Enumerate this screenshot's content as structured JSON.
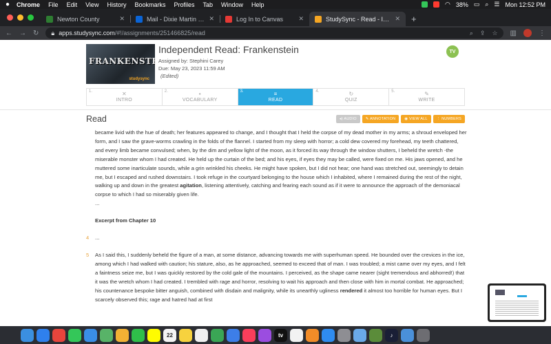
{
  "menubar": {
    "app": "Chrome",
    "items": [
      "File",
      "Edit",
      "View",
      "History",
      "Bookmarks",
      "Profiles",
      "Tab",
      "Window",
      "Help"
    ],
    "battery": "38%",
    "clock": "Mon 12:52 PM"
  },
  "tabs": [
    {
      "title": "Newton County",
      "color": "#2e7d32"
    },
    {
      "title": "Mail - Dixie Martin - Outlook",
      "color": "#0a64d6"
    },
    {
      "title": "Log In to Canvas",
      "color": "#e53935"
    },
    {
      "title": "StudySync - Read - Independ",
      "color": "#f5a623"
    }
  ],
  "address": {
    "domain": "apps.studysync.com",
    "path": "/#!/assignments/251466825/read"
  },
  "assignment": {
    "cover_title": "FRANKENSTEIN",
    "cover_brand": "studysync",
    "title": "Independent Read: Frankenstein",
    "assigned_by": "Assigned by: Stephini Carey",
    "due": "Due: May 23, 2023 11:59 AM",
    "edited": "(Edited)",
    "user_initials": "TV"
  },
  "steps": [
    {
      "num": "1.",
      "label": "INTRO",
      "icon": "✕"
    },
    {
      "num": "2.",
      "label": "VOCABULARY",
      "icon": "▪"
    },
    {
      "num": "3.",
      "label": "READ",
      "icon": "≡"
    },
    {
      "num": "4.",
      "label": "QUIZ",
      "icon": "↻"
    },
    {
      "num": "5.",
      "label": "WRITE",
      "icon": "✎"
    }
  ],
  "read": {
    "title": "Read",
    "actions": {
      "audio": "◂) AUDIO",
      "annotation": "✎ ANNOTATION",
      "view_all": "◉ VIEW ALL",
      "numbers": "⋮ NUMBERS"
    },
    "para1_before_bold": "became livid with the hue of death; her features appeared to change, and I thought that I held the corpse of my dead mother in my arms; a shroud enveloped her form, and I saw the grave-worms crawling in the folds of the flannel. I started from my sleep with horror; a cold dew covered my forehead, my teeth chattered, and every limb became convulsed; when, by the dim and yellow light of the moon, as it forced its way through the window shutters, I beheld the wretch -the miserable monster whom I had created. He held up the curtain of the bed; and his eyes, if eyes they may be called, were fixed on me. His jaws opened, and he muttered some inarticulate sounds, while a grin wrinkled his cheeks. He might have spoken, but I did not hear; one hand was stretched out, seemingly to detain me, but I escaped and rushed downstairs. I took refuge in the courtyard belonging to the house which I inhabited, where I remained during the rest of the night, walking up and down in the greatest",
    "para1_bold": "agitation",
    "para1_after_bold": ", listening attentively, catching and fearing each sound as if it were to announce the approach of the demoniacal corpse to which I had so miserably given life.",
    "ellipsis1": "...",
    "excerpt_heading": "Excerpt from Chapter 10",
    "para4_num": "4",
    "para4_text": "...",
    "para5_num": "5",
    "para5_before_bold": "As I said this, I suddenly beheld the figure of a man, at some distance, advancing towards me with superhuman speed. He bounded over the crevices in the ice, among which I had walked with caution; his stature, also, as he approached, seemed to exceed that of man. I was troubled; a mist came over my eyes, and I felt a faintness seize me, but I was quickly restored by the cold gale of the mountains. I perceived, as the shape came nearer (sight tremendous and abhorred!) that it was the wretch whom I had created. I trembled with rage and horror, resolving to wait his approach and then close with him in mortal combat. He approached; his countenance bespoke bitter anguish, combined with disdain and malignity, while its unearthly ugliness",
    "para5_bold": "rendered",
    "para5_after_bold": "it almost too horrible for human eyes. But I scarcely observed this; rage and hatred had at first"
  },
  "dock": [
    {
      "name": "finder-icon",
      "color": "#3b8fe0",
      "label": ""
    },
    {
      "name": "safari-icon",
      "color": "#2f80ed",
      "label": ""
    },
    {
      "name": "chrome-icon",
      "color": "#e8453c",
      "label": ""
    },
    {
      "name": "messages-icon",
      "color": "#34c759",
      "label": ""
    },
    {
      "name": "mail-icon",
      "color": "#3a8ee6",
      "label": ""
    },
    {
      "name": "maps-icon",
      "color": "#58b368",
      "label": ""
    },
    {
      "name": "photos-icon",
      "color": "#f2b134",
      "label": ""
    },
    {
      "name": "facetime-icon",
      "color": "#2fbf4a",
      "label": ""
    },
    {
      "name": "snapchat-icon",
      "color": "#fffc00",
      "label": ""
    },
    {
      "name": "calendar-icon",
      "color": "#f4f4f4",
      "label": "22"
    },
    {
      "name": "notes-icon",
      "color": "#f7d23e",
      "label": ""
    },
    {
      "name": "reminders-icon",
      "color": "#f0f0f0",
      "label": ""
    },
    {
      "name": "numbers-icon",
      "color": "#3aa655",
      "label": ""
    },
    {
      "name": "keynote-icon",
      "color": "#3d7ee8",
      "label": ""
    },
    {
      "name": "music-icon",
      "color": "#fa3e5b",
      "label": ""
    },
    {
      "name": "podcasts-icon",
      "color": "#9b4de0",
      "label": ""
    },
    {
      "name": "tv-icon",
      "color": "#111111",
      "label": "tv"
    },
    {
      "name": "news-icon",
      "color": "#f2f2f2",
      "label": ""
    },
    {
      "name": "books-icon",
      "color": "#f28c28",
      "label": ""
    },
    {
      "name": "appstore-icon",
      "color": "#2f8cf0",
      "label": ""
    },
    {
      "name": "settings-icon",
      "color": "#8e8e93",
      "label": ""
    },
    {
      "name": "preview-icon",
      "color": "#6aa9e8",
      "label": ""
    },
    {
      "name": "minecraft-icon",
      "color": "#5b8c3a",
      "label": ""
    },
    {
      "name": "amazon-music-icon",
      "color": "#1a1f36",
      "label": "♪"
    },
    {
      "name": "downloads-icon",
      "color": "#4a90d9",
      "label": ""
    },
    {
      "name": "trash-icon",
      "color": "#6d6d72",
      "label": ""
    }
  ]
}
